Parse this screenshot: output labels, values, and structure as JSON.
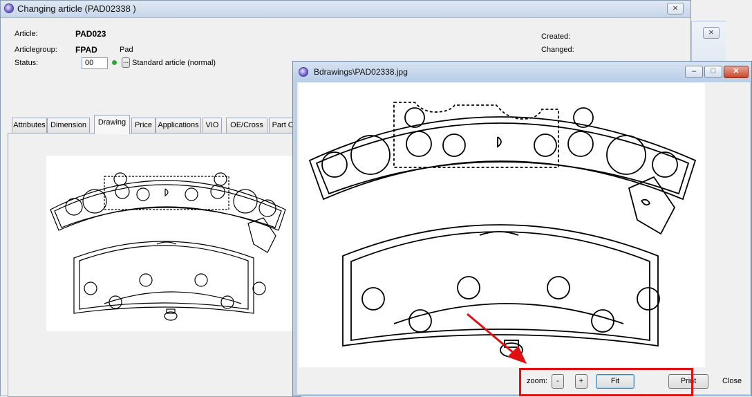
{
  "main_window": {
    "title": "Changing article  (PAD02338       )",
    "close_label": "⨯",
    "fields": {
      "article_label": "Article:",
      "article_value": "PAD023",
      "articlegroup_label": "Articlegroup:",
      "articlegroup_value": "FPAD",
      "articlegroup_desc": "Pad",
      "status_label": "Status:",
      "status_value": "00",
      "status_browse": "...",
      "status_desc": "Standard article (normal)",
      "created_label": "Created:",
      "changed_label": "Changed:"
    },
    "tabs": [
      {
        "label": "Attributes"
      },
      {
        "label": "Dimension"
      },
      {
        "label": "Drawing"
      },
      {
        "label": "Price"
      },
      {
        "label": "Applications"
      },
      {
        "label": "VIO"
      },
      {
        "label": "OE/Cross"
      },
      {
        "label": "Part Of"
      }
    ],
    "active_tab": "Drawing"
  },
  "background_window": {
    "close_label": "⨯"
  },
  "image_window": {
    "title": "Bdrawings\\PAD02338.jpg",
    "minimize_label": "–",
    "maximize_label": "□",
    "close_label": "✕",
    "zoom_label": "zoom:",
    "zoom_out_label": "-",
    "zoom_in_label": "+",
    "fit_label": "Fit",
    "print_label": "Print",
    "close_button_label": "Close"
  },
  "colors": {
    "highlight": "#e01010",
    "status_dot": "#2aa830"
  }
}
